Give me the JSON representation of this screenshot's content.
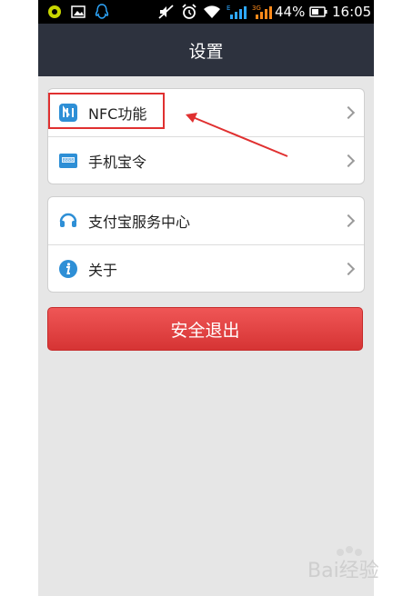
{
  "status_bar": {
    "battery_percent": "44%",
    "time": "16:05",
    "network_label": "3G"
  },
  "header": {
    "title": "设置"
  },
  "settings": {
    "group1": [
      {
        "label": "NFC功能",
        "icon": "nfc-icon"
      },
      {
        "label": "手机宝令",
        "icon": "phone-token-icon"
      }
    ],
    "group2": [
      {
        "label": "支付宝服务中心",
        "icon": "headset-icon"
      },
      {
        "label": "关于",
        "icon": "info-icon"
      }
    ]
  },
  "logout_button": {
    "label": "安全退出"
  },
  "watermark": {
    "text": "Bai经验"
  },
  "colors": {
    "title_bar": "#2d323e",
    "background": "#e6e6e6",
    "logout_red": "#e04444",
    "icon_blue": "#2e8fd6",
    "annotation_red": "#e03030"
  }
}
